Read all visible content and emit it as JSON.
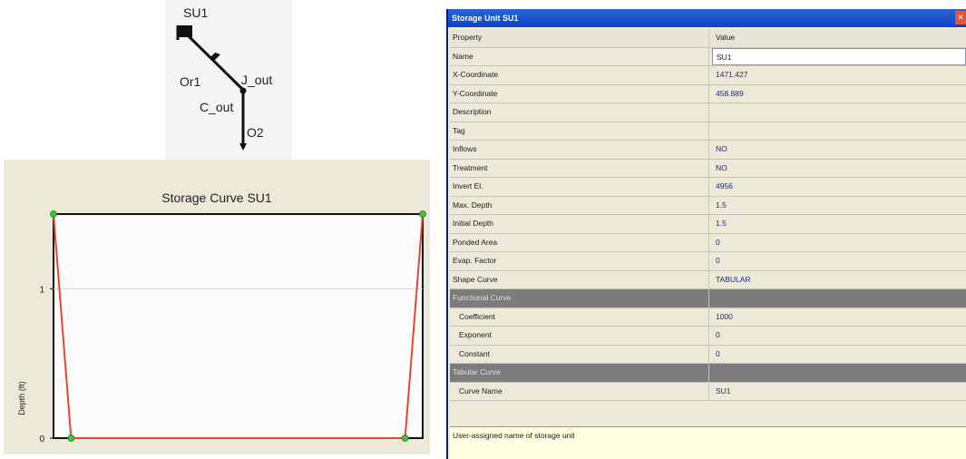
{
  "schematic": {
    "labels": {
      "storage": "SU1",
      "orifice": "Or1",
      "junction": "J_out",
      "conduit": "C_out",
      "outfall": "O2"
    }
  },
  "chart_data": {
    "type": "line",
    "title": "Storage Curve SU1",
    "xlabel": "",
    "ylabel": "Depth (ft)",
    "x": [
      0,
      1,
      20,
      21
    ],
    "y": [
      1.5,
      0,
      0,
      1.5
    ],
    "xlim": [
      0,
      21
    ],
    "ylim": [
      0,
      1.5
    ],
    "yticks": [
      "0",
      "1"
    ],
    "grid": true,
    "line_color": "#e8452f",
    "marker_color": "#3cc43c"
  },
  "property_editor": {
    "title": "Storage Unit SU1",
    "close_label": "×",
    "header": {
      "property": "Property",
      "value": "Value"
    },
    "rows": [
      {
        "property": "Name",
        "value": "SU1",
        "type": "editing"
      },
      {
        "property": "X-Coordinate",
        "value": "1471.427",
        "type": "normal"
      },
      {
        "property": "Y-Coordinate",
        "value": "458.889",
        "type": "normal"
      },
      {
        "property": "Description",
        "value": "",
        "type": "normal"
      },
      {
        "property": "Tag",
        "value": "",
        "type": "normal"
      },
      {
        "property": "Inflows",
        "value": "NO",
        "type": "normal"
      },
      {
        "property": "Treatment",
        "value": "NO",
        "type": "normal"
      },
      {
        "property": "Invert El.",
        "value": "4956",
        "type": "normal"
      },
      {
        "property": "Max. Depth",
        "value": "1.5",
        "type": "normal"
      },
      {
        "property": "Initial Depth",
        "value": "1.5",
        "type": "normal"
      },
      {
        "property": "Ponded Area",
        "value": "0",
        "type": "normal"
      },
      {
        "property": "Evap. Factor",
        "value": "0",
        "type": "normal"
      },
      {
        "property": "Shape Curve",
        "value": "TABULAR",
        "type": "normal"
      },
      {
        "property": "Functional Curve",
        "value": "",
        "type": "section"
      },
      {
        "property": "Coefficient",
        "value": "1000",
        "type": "indent"
      },
      {
        "property": "Exponent",
        "value": "0",
        "type": "indent"
      },
      {
        "property": "Constant",
        "value": "0",
        "type": "indent"
      },
      {
        "property": "Tabular Curve",
        "value": "",
        "type": "section"
      },
      {
        "property": "Curve Name",
        "value": "SU1",
        "type": "indent"
      }
    ],
    "description": "User-assigned name of storage unit"
  }
}
